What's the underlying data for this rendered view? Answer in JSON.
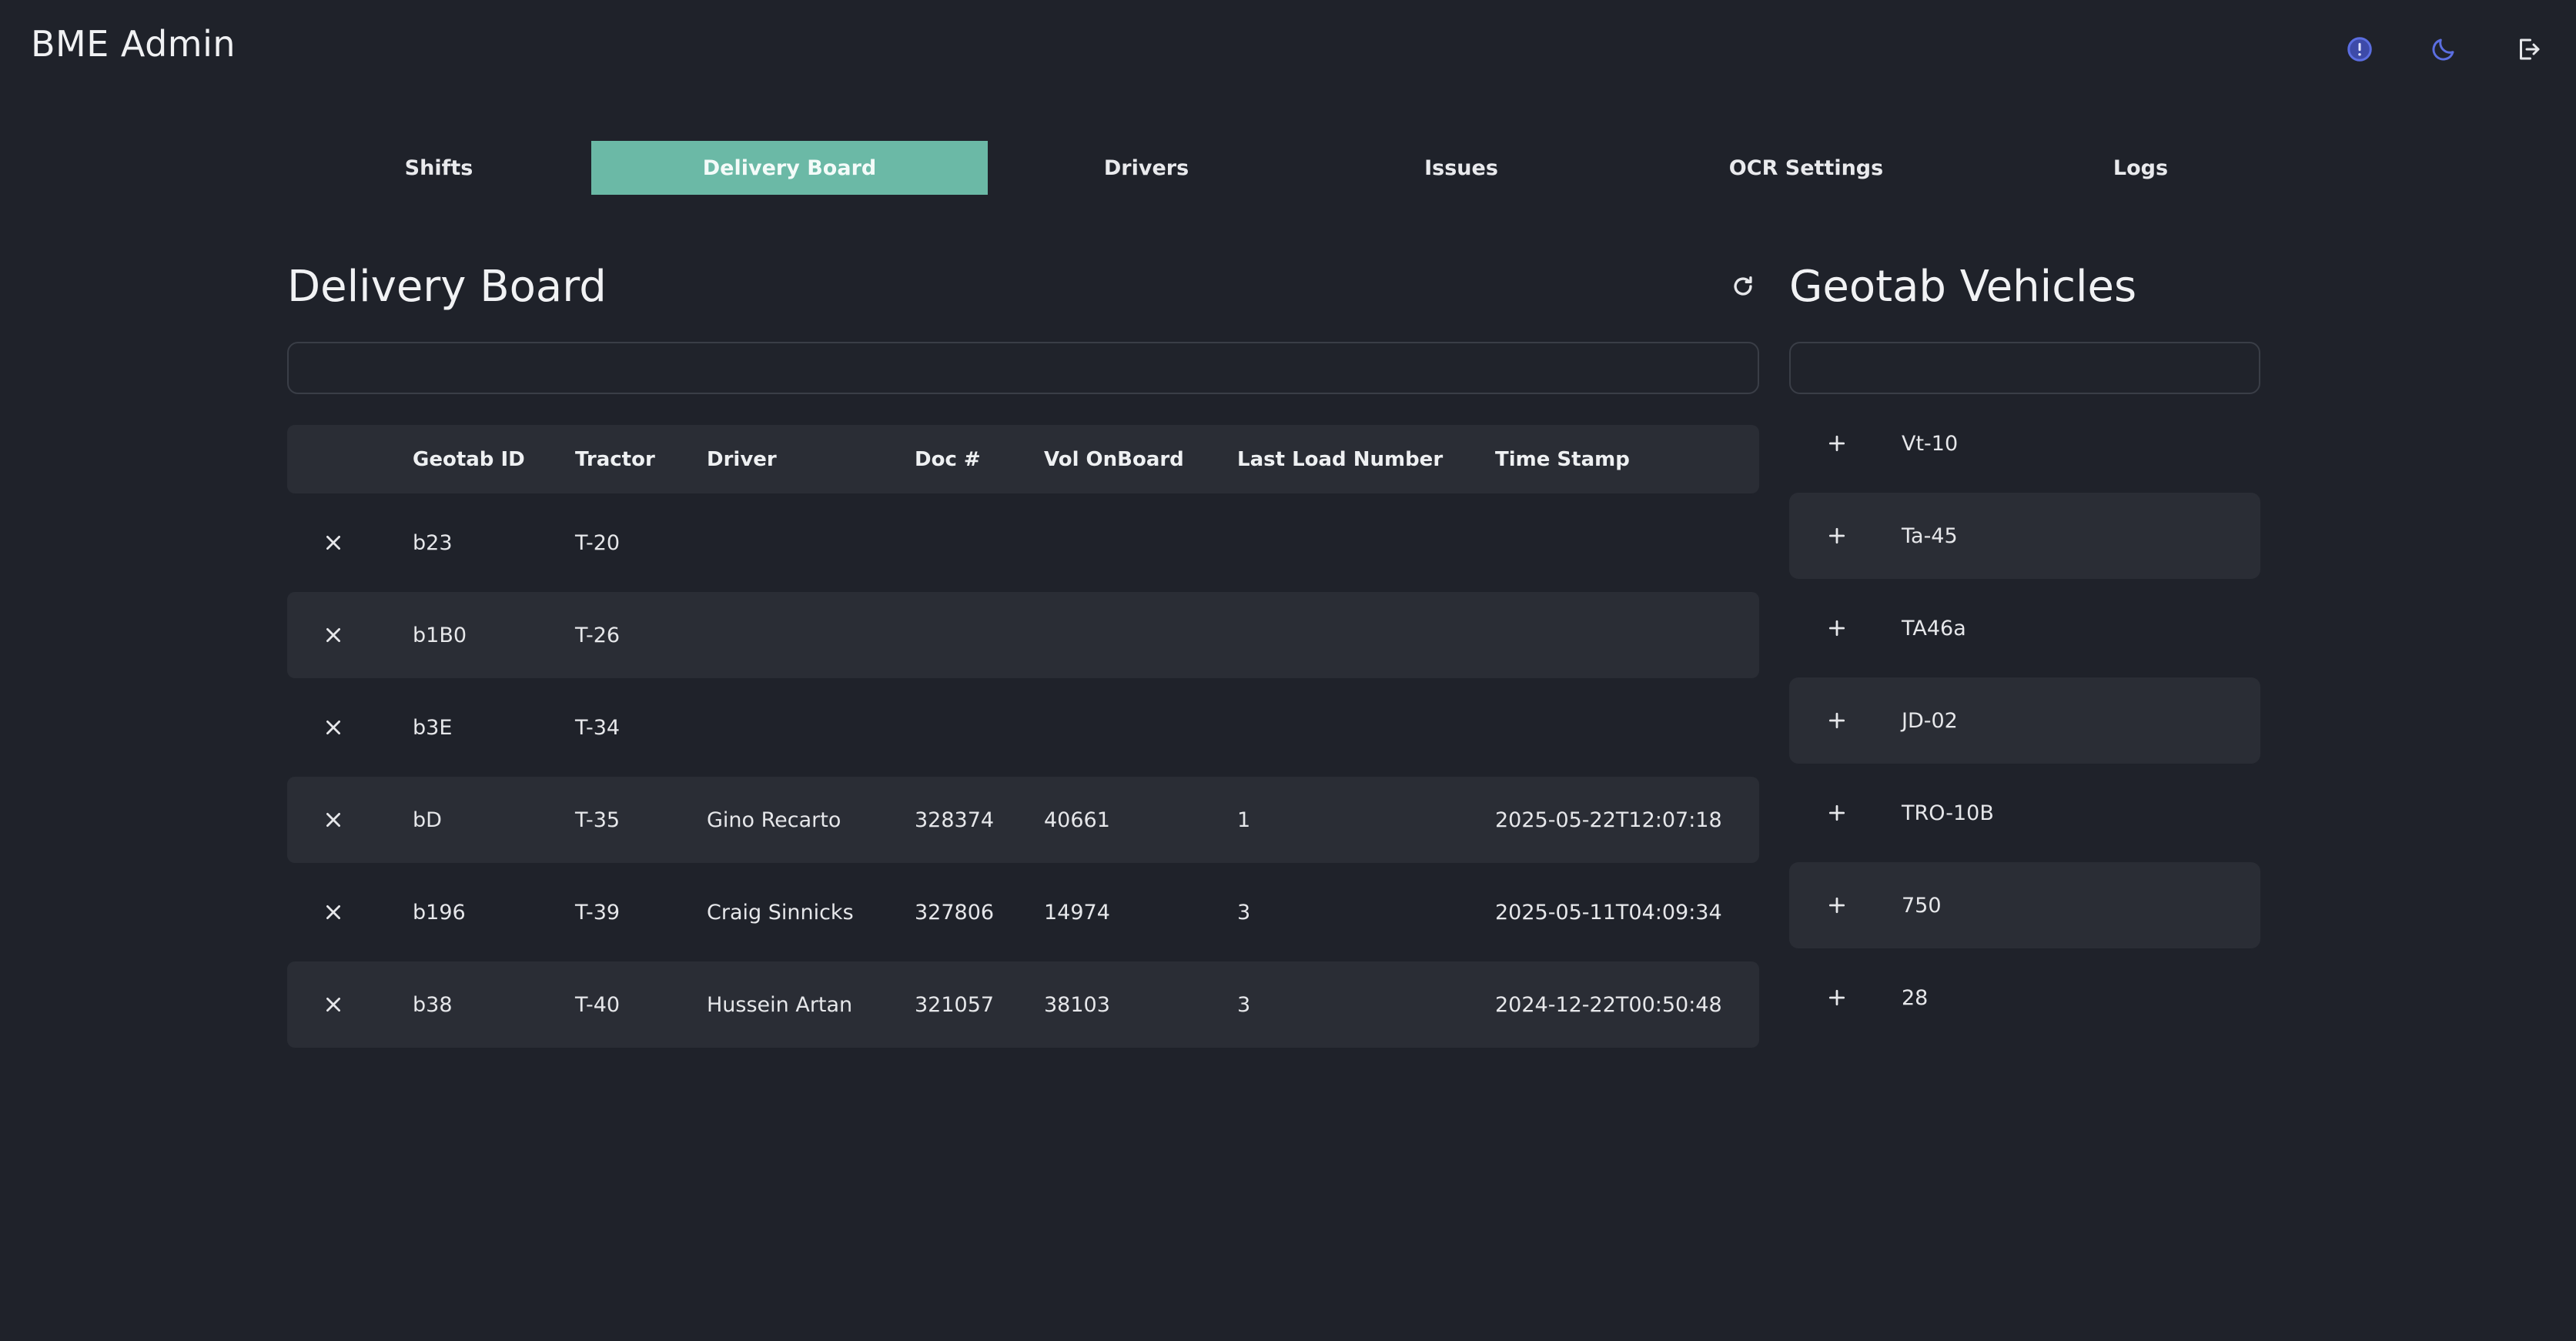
{
  "app": {
    "title": "BME Admin"
  },
  "header_icons": [
    {
      "name": "info-icon",
      "color": "#5b6ee1"
    },
    {
      "name": "moon-icon",
      "color": "#5b6ee1"
    },
    {
      "name": "logout-icon",
      "color": "#e6e7ea"
    }
  ],
  "nav": {
    "tabs": [
      {
        "label": "Shifts",
        "active": false
      },
      {
        "label": "Delivery Board",
        "active": true
      },
      {
        "label": "Drivers",
        "active": false
      },
      {
        "label": "Issues",
        "active": false
      },
      {
        "label": "OCR Settings",
        "active": false
      },
      {
        "label": "Logs",
        "active": false
      }
    ],
    "active_color": "#6bb9a6"
  },
  "delivery_board": {
    "title": "Delivery Board",
    "search_value": "",
    "columns": [
      "",
      "Geotab ID",
      "Tractor",
      "Driver",
      "Doc #",
      "Vol OnBoard",
      "Last Load Number",
      "Time Stamp"
    ],
    "rows": [
      {
        "geotab_id": "b23",
        "tractor": "T-20",
        "driver": "",
        "doc": "",
        "vol": "",
        "last_load": "",
        "timestamp": ""
      },
      {
        "geotab_id": "b1B0",
        "tractor": "T-26",
        "driver": "",
        "doc": "",
        "vol": "",
        "last_load": "",
        "timestamp": ""
      },
      {
        "geotab_id": "b3E",
        "tractor": "T-34",
        "driver": "",
        "doc": "",
        "vol": "",
        "last_load": "",
        "timestamp": ""
      },
      {
        "geotab_id": "bD",
        "tractor": "T-35",
        "driver": "Gino Recarto",
        "doc": "328374",
        "vol": "40661",
        "last_load": "1",
        "timestamp": "2025-05-22T12:07:18"
      },
      {
        "geotab_id": "b196",
        "tractor": "T-39",
        "driver": "Craig Sinnicks",
        "doc": "327806",
        "vol": "14974",
        "last_load": "3",
        "timestamp": "2025-05-11T04:09:34"
      },
      {
        "geotab_id": "b38",
        "tractor": "T-40",
        "driver": "Hussein Artan",
        "doc": "321057",
        "vol": "38103",
        "last_load": "3",
        "timestamp": "2024-12-22T00:50:48"
      }
    ]
  },
  "geotab_vehicles": {
    "title": "Geotab Vehicles",
    "search_value": "",
    "items": [
      "Vt-10",
      "Ta-45",
      "TA46a",
      "JD-02",
      "TRO-10B",
      "750",
      "28"
    ]
  }
}
